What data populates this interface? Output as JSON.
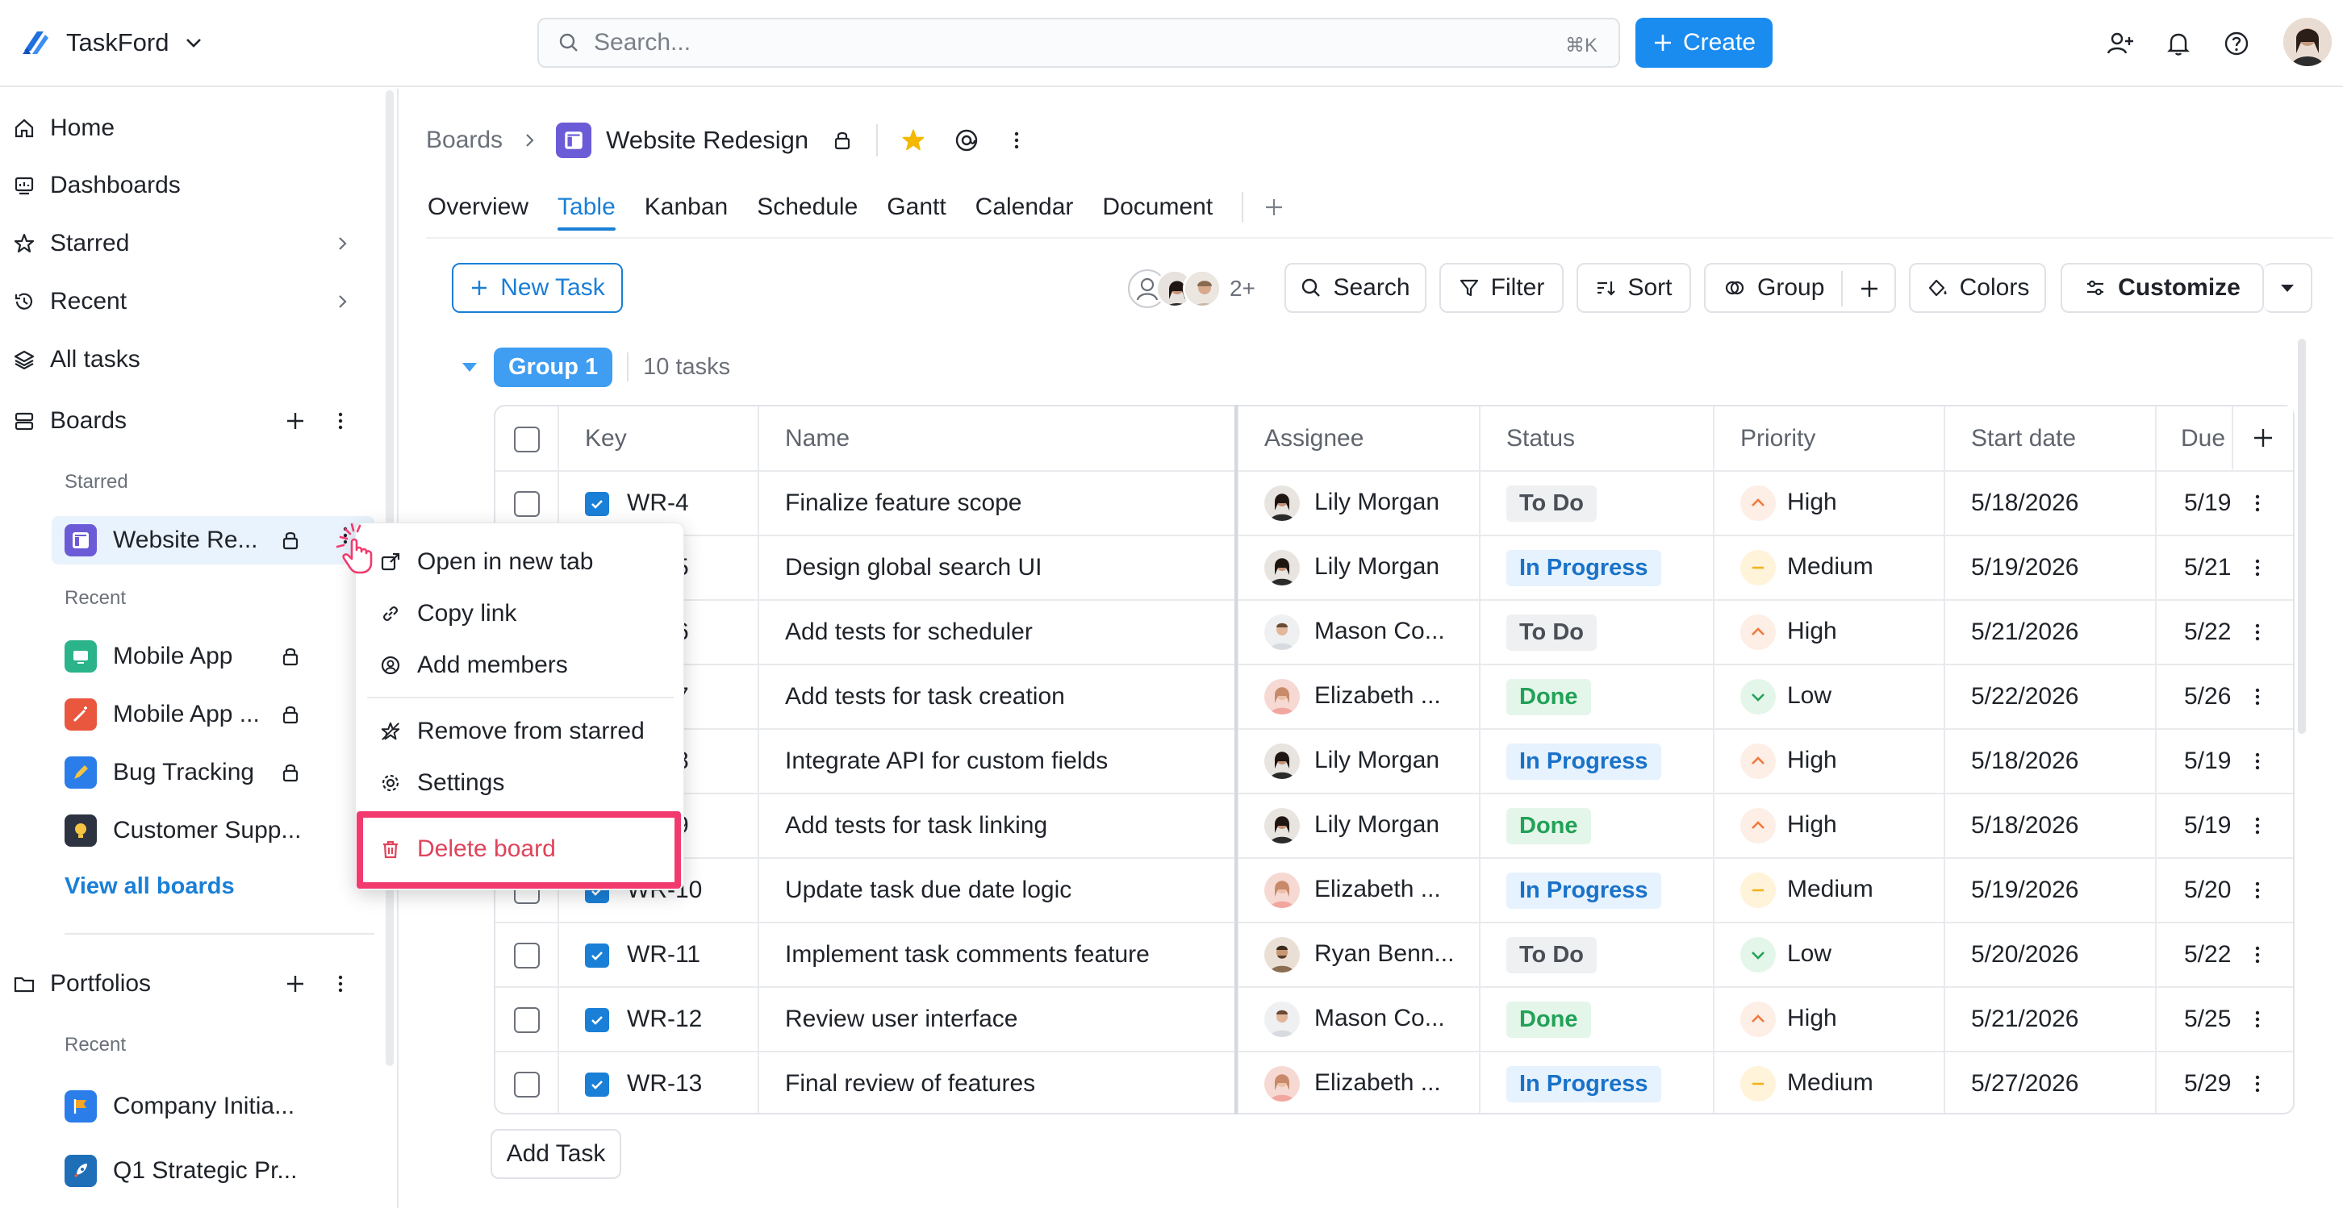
{
  "app": {
    "name": "TaskFord",
    "search_placeholder": "Search...",
    "search_shortcut": "⌘K",
    "create_label": "Create"
  },
  "sidebar": {
    "nav": [
      {
        "label": "Home",
        "icon": "home-icon"
      },
      {
        "label": "Dashboards",
        "icon": "dashboard-icon"
      },
      {
        "label": "Starred",
        "icon": "star-icon"
      },
      {
        "label": "Recent",
        "icon": "history-icon"
      },
      {
        "label": "All tasks",
        "icon": "layers-icon"
      }
    ],
    "boards_label": "Boards",
    "starred_label": "Starred",
    "recent_label": "Recent",
    "starred_boards": [
      {
        "name": "Website Re...",
        "icon": "board-icon",
        "color": "#6b5bd6"
      }
    ],
    "recent_boards": [
      {
        "name": "Mobile App",
        "icon": "monitor-icon",
        "color": "#2bb38a"
      },
      {
        "name": "Mobile App ...",
        "icon": "wand-icon",
        "color": "#e9573f"
      },
      {
        "name": "Bug Tracking",
        "icon": "pencil-icon",
        "color": "#2b7de9"
      },
      {
        "name": "Customer Supp...",
        "icon": "lightbulb-icon",
        "color": "#2d3340"
      }
    ],
    "view_all_boards": "View all boards",
    "portfolios_label": "Portfolios",
    "portfolios_recent_label": "Recent",
    "portfolios": [
      {
        "name": "Company Initia...",
        "icon": "flag-icon",
        "color": "#2b7de9"
      },
      {
        "name": "Q1 Strategic Pr...",
        "icon": "rocket-icon",
        "color": "#1f6fb8"
      }
    ]
  },
  "header": {
    "breadcrumb_root": "Boards",
    "title": "Website Redesign",
    "tabs": [
      "Overview",
      "Table",
      "Kanban",
      "Schedule",
      "Gantt",
      "Calendar",
      "Document"
    ],
    "active_tab": "Table"
  },
  "toolbar": {
    "new_task": "New Task",
    "members_more": "2+",
    "search": "Search",
    "filter": "Filter",
    "sort": "Sort",
    "group": "Group",
    "colors": "Colors",
    "customize": "Customize"
  },
  "group": {
    "name": "Group 1",
    "count": "10 tasks"
  },
  "table": {
    "columns": [
      "Key",
      "Name",
      "Assignee",
      "Status",
      "Priority",
      "Start date",
      "Due"
    ],
    "rows": [
      {
        "key": "WR-4",
        "name": "Finalize feature scope",
        "assignee": "Lily Morgan",
        "avatar": "lily",
        "status": "To Do",
        "priority": "High",
        "start": "5/18/2026",
        "due": "5/19"
      },
      {
        "key": "WR-5",
        "name": "Design global search UI",
        "assignee": "Lily Morgan",
        "avatar": "lily",
        "status": "In Progress",
        "priority": "Medium",
        "start": "5/19/2026",
        "due": "5/21"
      },
      {
        "key": "WR-6",
        "name": "Add tests for scheduler",
        "assignee": "Mason Co...",
        "avatar": "mason",
        "status": "To Do",
        "priority": "High",
        "start": "5/21/2026",
        "due": "5/22"
      },
      {
        "key": "WR-7",
        "name": "Add tests for task creation",
        "assignee": "Elizabeth ...",
        "avatar": "elizabeth",
        "status": "Done",
        "priority": "Low",
        "start": "5/22/2026",
        "due": "5/26"
      },
      {
        "key": "WR-8",
        "name": "Integrate API for custom fields",
        "assignee": "Lily Morgan",
        "avatar": "lily",
        "status": "In Progress",
        "priority": "High",
        "start": "5/18/2026",
        "due": "5/19"
      },
      {
        "key": "WR-9",
        "name": "Add tests for task linking",
        "assignee": "Lily Morgan",
        "avatar": "lily",
        "status": "Done",
        "priority": "High",
        "start": "5/18/2026",
        "due": "5/19"
      },
      {
        "key": "WR-10",
        "name": "Update task due date logic",
        "assignee": "Elizabeth ...",
        "avatar": "elizabeth",
        "status": "In Progress",
        "priority": "Medium",
        "start": "5/19/2026",
        "due": "5/20"
      },
      {
        "key": "WR-11",
        "name": "Implement task comments feature",
        "assignee": "Ryan Benn...",
        "avatar": "ryan",
        "status": "To Do",
        "priority": "Low",
        "start": "5/20/2026",
        "due": "5/22"
      },
      {
        "key": "WR-12",
        "name": "Review user interface",
        "assignee": "Mason Co...",
        "avatar": "mason",
        "status": "Done",
        "priority": "High",
        "start": "5/21/2026",
        "due": "5/25"
      },
      {
        "key": "WR-13",
        "name": "Final review of features",
        "assignee": "Elizabeth ...",
        "avatar": "elizabeth",
        "status": "In Progress",
        "priority": "Medium",
        "start": "5/27/2026",
        "due": "5/29"
      }
    ],
    "add_task": "Add Task"
  },
  "context_menu": {
    "items": [
      {
        "label": "Open in new tab",
        "icon": "external-link-icon"
      },
      {
        "label": "Copy link",
        "icon": "link-icon"
      },
      {
        "label": "Add members",
        "icon": "add-member-icon"
      },
      {
        "label": "Remove from starred",
        "icon": "star-off-icon"
      },
      {
        "label": "Settings",
        "icon": "gear-icon"
      },
      {
        "label": "Delete board",
        "icon": "trash-icon"
      }
    ]
  },
  "colors": {
    "accent": "#1a7fd6",
    "danger": "#e0435a",
    "highlight": "#f23a6e"
  }
}
